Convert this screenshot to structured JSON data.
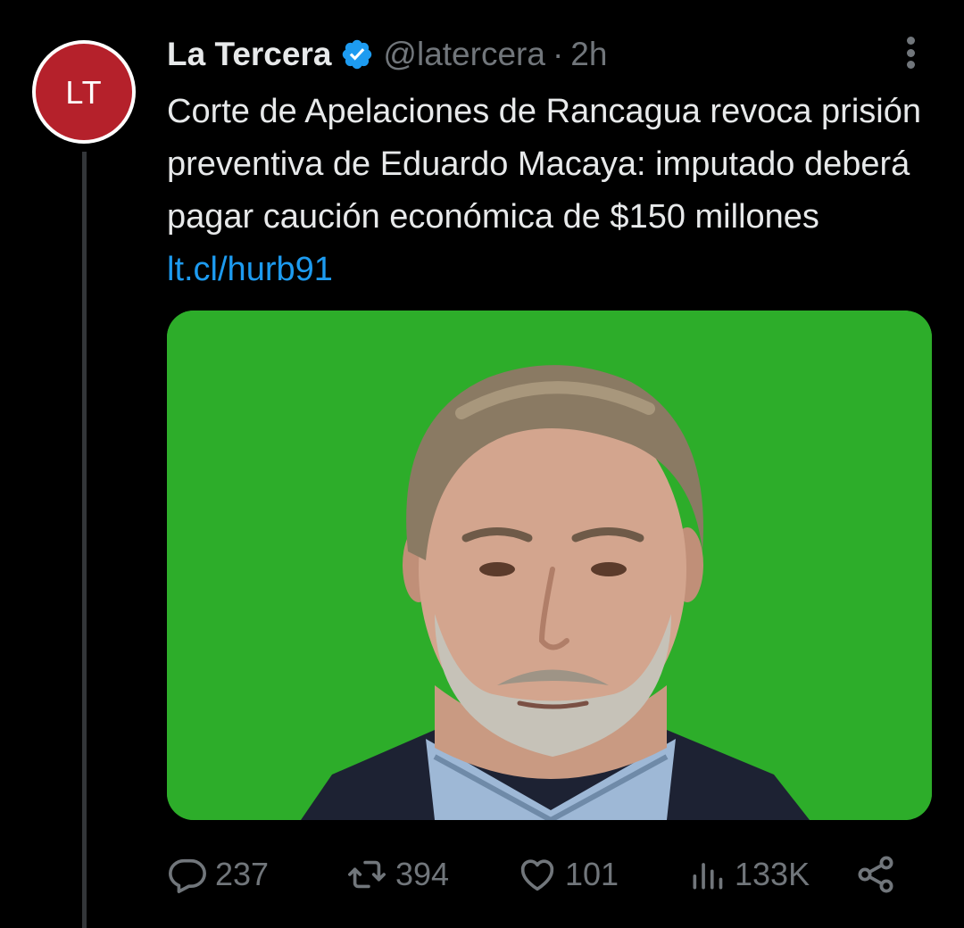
{
  "account": {
    "avatar_text": "LT",
    "display_name": "La Tercera",
    "verified": true,
    "handle": "@latercera",
    "separator": "·",
    "time": "2h"
  },
  "tweet": {
    "text": "Corte de Apelaciones de Rancagua revoca prisión preventiva de Eduardo Macaya: imputado deberá pagar caución económica de $150 millones",
    "link": "lt.cl/hurb91"
  },
  "media": {
    "kind": "photo",
    "background_color": "#2dad2a"
  },
  "actions": {
    "replies": "237",
    "reposts": "394",
    "likes": "101",
    "views": "133K"
  },
  "icons": {
    "more": "more-vertical-icon",
    "verified": "verified-badge-icon",
    "reply": "reply-icon",
    "repost": "repost-icon",
    "like": "heart-icon",
    "views": "views-icon",
    "share": "share-icon"
  },
  "colors": {
    "background": "#000000",
    "text": "#e7e9ea",
    "secondary": "#71767b",
    "link": "#1d9bf0",
    "verified": "#1d9bf0",
    "avatar_bg": "#b5212b"
  }
}
